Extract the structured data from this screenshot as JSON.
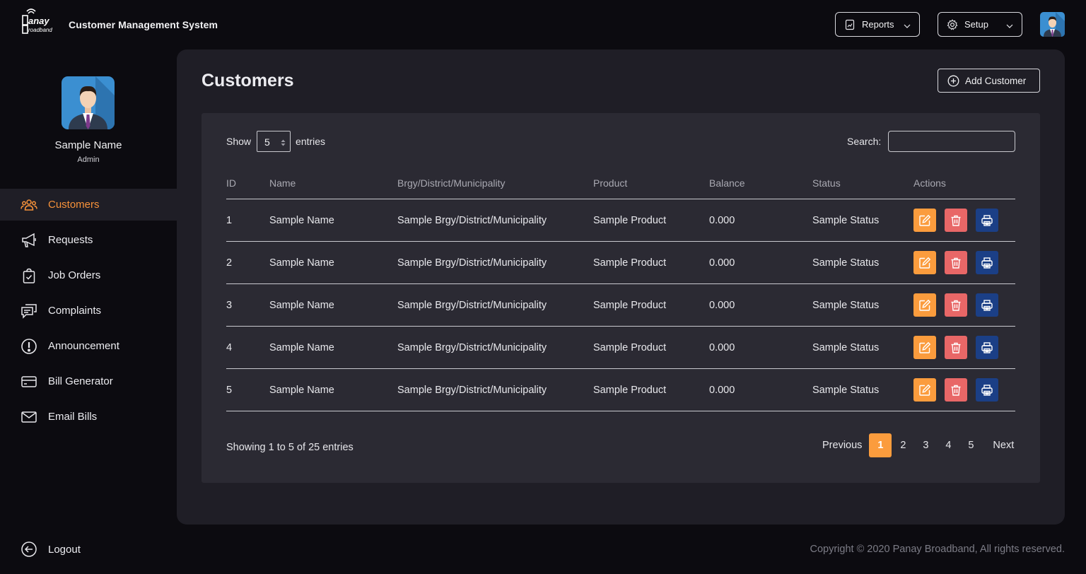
{
  "header": {
    "app_title": "Customer Management System",
    "logo_text": "Panay Broadband",
    "reports_label": "Reports",
    "setup_label": "Setup"
  },
  "profile": {
    "name": "Sample Name",
    "role": "Admin"
  },
  "sidebar": {
    "items": [
      {
        "label": "Customers",
        "icon": "users-icon",
        "active": true
      },
      {
        "label": "Requests",
        "icon": "megaphone-icon"
      },
      {
        "label": "Job Orders",
        "icon": "clipboard-check-icon"
      },
      {
        "label": "Complaints",
        "icon": "chat-icon"
      },
      {
        "label": "Announcement",
        "icon": "alert-circle-icon"
      },
      {
        "label": "Bill Generator",
        "icon": "credit-card-icon"
      },
      {
        "label": "Email Bills",
        "icon": "mail-icon"
      }
    ],
    "logout_label": "Logout"
  },
  "main": {
    "title": "Customers",
    "add_button_label": "Add Customer",
    "show_label": "Show",
    "page_size": "5",
    "entries_label": "entries",
    "search_label": "Search:",
    "search_value": "",
    "columns": [
      "ID",
      "Name",
      "Brgy/District/Municipality",
      "Product",
      "Balance",
      "Status",
      "Actions"
    ],
    "rows": [
      {
        "id": "1",
        "name": "Sample Name",
        "brgy": "Sample Brgy/District/Municipality",
        "product": "Sample Product",
        "balance": "0.000",
        "status": "Sample Status"
      },
      {
        "id": "2",
        "name": "Sample Name",
        "brgy": "Sample Brgy/District/Municipality",
        "product": "Sample Product",
        "balance": "0.000",
        "status": "Sample Status"
      },
      {
        "id": "3",
        "name": "Sample Name",
        "brgy": "Sample Brgy/District/Municipality",
        "product": "Sample Product",
        "balance": "0.000",
        "status": "Sample Status"
      },
      {
        "id": "4",
        "name": "Sample Name",
        "brgy": "Sample Brgy/District/Municipality",
        "product": "Sample Product",
        "balance": "0.000",
        "status": "Sample Status"
      },
      {
        "id": "5",
        "name": "Sample Name",
        "brgy": "Sample Brgy/District/Municipality",
        "product": "Sample Product",
        "balance": "0.000",
        "status": "Sample Status"
      }
    ],
    "info": "Showing 1 to 5 of 25 entries",
    "pagination": {
      "previous": "Previous",
      "pages": [
        "1",
        "2",
        "3",
        "4",
        "5"
      ],
      "current": "1",
      "next": "Next"
    }
  },
  "footer": {
    "copyright": "Copyright  © 2020 Panay Broadband, All rights reserved."
  },
  "colors": {
    "accent": "#fb9c3d",
    "delete": "#e86767",
    "print": "#1b3f86",
    "background": "#0c0b10",
    "panel": "#1f1e26",
    "card": "#2b2a33"
  }
}
